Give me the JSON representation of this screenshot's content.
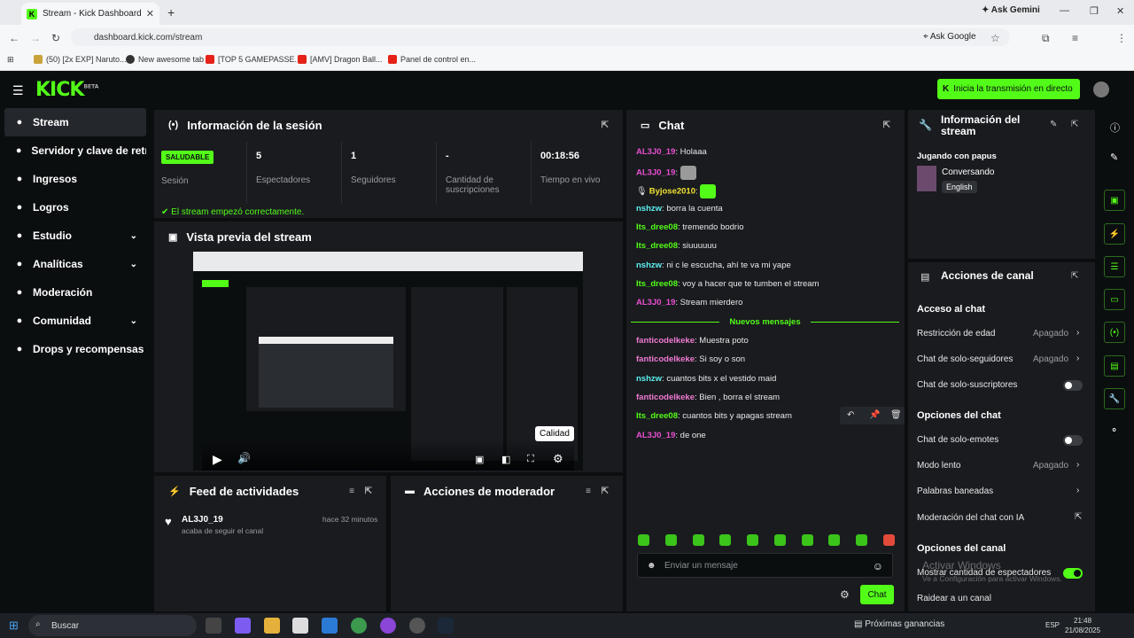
{
  "browser": {
    "tab_title": "Stream - Kick Dashboard",
    "ask_gemini": "Ask Gemini",
    "url": "dashboard.kick.com/stream",
    "ask_google": "Ask Google",
    "bookmarks": [
      "(50) [2x EXP] Naruto...",
      "New awesome tab",
      "[TOP 5 GAMEPASSE...",
      "[AMV] Dragon Ball...",
      "Panel de control en..."
    ]
  },
  "kick": {
    "logo": "KICK",
    "beta": "BETA",
    "go_live": "Inicia la transmisión en directo"
  },
  "nav": [
    {
      "label": "Stream",
      "icon": "broadcast-icon"
    },
    {
      "label": "Servidor y clave de retran",
      "icon": "link-icon"
    },
    {
      "label": "Ingresos",
      "icon": "money-icon"
    },
    {
      "label": "Logros",
      "icon": "trophy-icon"
    },
    {
      "label": "Estudio",
      "icon": "studio-icon",
      "chev": true
    },
    {
      "label": "Analíticas",
      "icon": "chart-icon",
      "chev": true
    },
    {
      "label": "Moderación",
      "icon": "hammer-icon"
    },
    {
      "label": "Comunidad",
      "icon": "community-icon",
      "chev": true
    },
    {
      "label": "Drops y recompensas",
      "icon": "gift-icon"
    }
  ],
  "session": {
    "title": "Información de la sesión",
    "status": "SALUDABLE",
    "status_label": "Sesión",
    "stats": [
      {
        "value": "5",
        "label": "Espectadores"
      },
      {
        "value": "1",
        "label": "Seguidores"
      },
      {
        "value": "-",
        "label": "Cantidad de suscripciones"
      },
      {
        "value": "00:18:56",
        "label": "Tiempo en vivo"
      }
    ],
    "ok_message": "El stream empezó correctamente."
  },
  "preview": {
    "title": "Vista previa del stream",
    "tooltip": "Calidad"
  },
  "feed": {
    "title": "Feed de actividades",
    "user": "AL3J0_19",
    "time": "hace 32 minutos",
    "action": "acaba de seguir el canal"
  },
  "modactions": {
    "title": "Acciones de moderador"
  },
  "chat": {
    "title": "Chat",
    "new_messages": "Nuevos mensajes",
    "placeholder": "Enviar un mensaje",
    "send": "Chat",
    "messages": [
      {
        "user": "AL3J0_19",
        "text": "Holaaa",
        "color": "#e84fd0"
      },
      {
        "user": "AL3J0_19",
        "text": "",
        "color": "#e84fd0"
      },
      {
        "user": "Byjose2010",
        "text": "",
        "color": "#f2e230"
      },
      {
        "user": "nshzw",
        "text": "borra la cuenta",
        "color": "#5ef0f0"
      },
      {
        "user": "Its_dree08",
        "text": "tremendo bodrio",
        "color": "#53fc18"
      },
      {
        "user": "Its_dree08",
        "text": "siuuuuuu",
        "color": "#53fc18"
      },
      {
        "user": "nshzw",
        "text": "ni c le escucha, ahí te va mi yape",
        "color": "#5ef0f0"
      },
      {
        "user": "Its_dree08",
        "text": "voy a hacer que te tumben el stream",
        "color": "#53fc18"
      },
      {
        "user": "AL3J0_19",
        "text": "Stream mierdero",
        "color": "#e84fd0"
      },
      {
        "user": "fanticodelkeke",
        "text": "Muestra poto",
        "color": "#f07ad2"
      },
      {
        "user": "fanticodelkeke",
        "text": "Si soy o son",
        "color": "#f07ad2"
      },
      {
        "user": "nshzw",
        "text": "cuantos bits x el vestido maid",
        "color": "#5ef0f0"
      },
      {
        "user": "fanticodelkeke",
        "text": "Bien , borra el stream",
        "color": "#f07ad2"
      },
      {
        "user": "Its_dree08",
        "text": "cuantos bits y apagas stream",
        "color": "#53fc18"
      },
      {
        "user": "AL3J0_19",
        "text": "de one",
        "color": "#e84fd0"
      }
    ]
  },
  "streaminfo": {
    "title": "Información del stream",
    "stream_title": "Jugando con papus",
    "category": "Conversando",
    "language": "English"
  },
  "channel": {
    "title": "Acciones de canal",
    "chat_access": "Acceso al chat",
    "age": "Restricción de edad",
    "age_val": "Apagado",
    "followers": "Chat de solo-seguidores",
    "followers_val": "Apagado",
    "subs": "Chat de solo-suscriptores",
    "chat_options": "Opciones del chat",
    "emotes": "Chat de solo-emotes",
    "slow": "Modo lento",
    "slow_val": "Apagado",
    "banned": "Palabras baneadas",
    "ai_mod": "Moderación del chat con IA",
    "channel_options": "Opciones del canal",
    "show_viewers": "Mostrar cantidad de espectadores",
    "raid": "Raidear a un canal"
  },
  "windows": {
    "watermark1": "Activar Windows",
    "watermark2": "Ve a Configuración para activar Windows.",
    "search": "Buscar",
    "news": "Próximas ganancias",
    "lang": "ESP",
    "time": "21:48",
    "date": "21/08/2025"
  }
}
